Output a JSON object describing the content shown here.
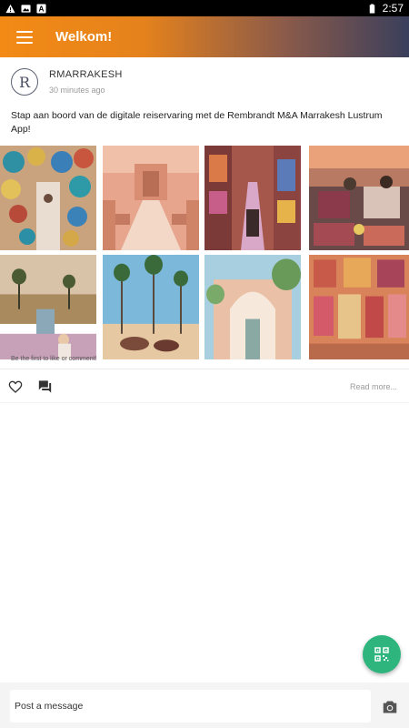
{
  "status_bar": {
    "time": "2:57",
    "icons": [
      "warning-icon",
      "image-icon",
      "app-a-icon",
      "battery-icon"
    ]
  },
  "app_bar": {
    "title": "Welkom!",
    "menu_icon": "hamburger-menu-icon"
  },
  "post": {
    "avatar_letter": "R",
    "author": "RMARRAKESH",
    "time": "30 minutes ago",
    "text": "Stap aan boord van de digitale reiservaring met de Rembrandt M&A Marrakesh Lustrum App!",
    "photos": [
      {
        "subject": "pottery-market"
      },
      {
        "subject": "palace-courtyard"
      },
      {
        "subject": "souk-alley"
      },
      {
        "subject": "rooftop-terrace"
      },
      {
        "subject": "palm-pool-view"
      },
      {
        "subject": "palm-desert-camels"
      },
      {
        "subject": "arched-gate"
      },
      {
        "subject": "rug-shop"
      }
    ],
    "like_hint": "Be the first to like or comment!",
    "read_more": "Read more..."
  },
  "composer": {
    "placeholder": "Post a message",
    "camera_icon": "camera-icon"
  },
  "fab": {
    "icon": "qr-code-icon"
  },
  "colors": {
    "accent_orange": "#f28a15",
    "accent_dark": "#3a3f5c",
    "fab_green": "#2db57d"
  }
}
